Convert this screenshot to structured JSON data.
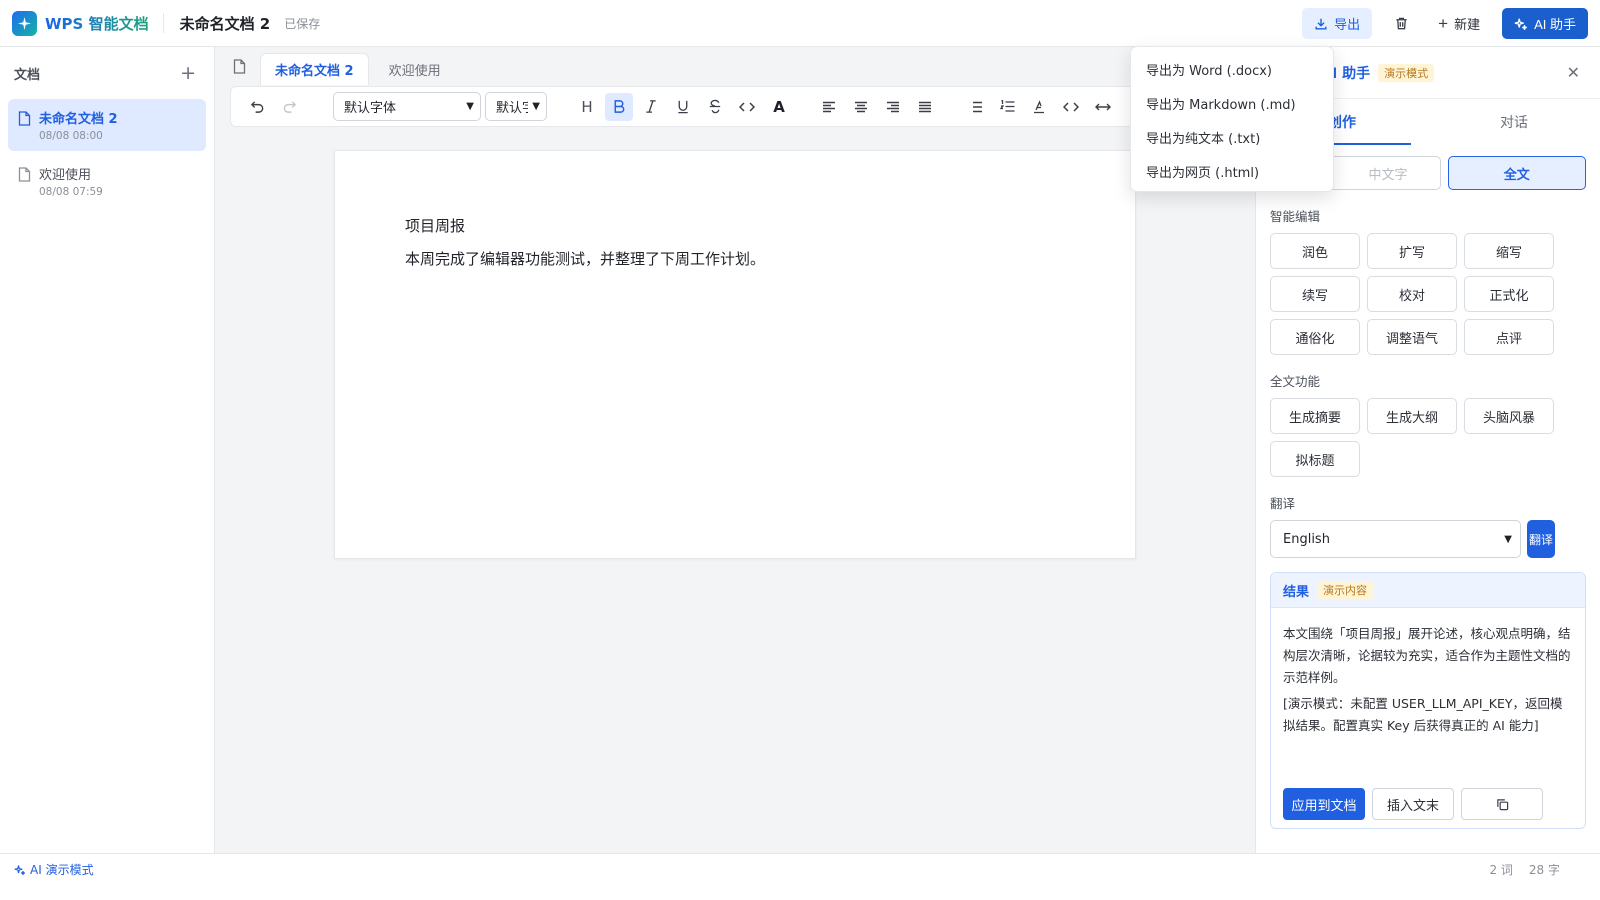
{
  "header": {
    "app_name": "WPS 智能文档",
    "doc_title": "未命名文档 2",
    "save_status": "已保存",
    "export_label": "导出",
    "new_label": "新建",
    "ai_label": "AI 助手"
  },
  "sidebar": {
    "title": "文档",
    "add": "+",
    "items": [
      {
        "name": "未命名文档 2",
        "date": "08/08 08:00",
        "active": true
      },
      {
        "name": "欢迎使用",
        "date": "08/08 07:59",
        "active": false
      }
    ]
  },
  "tabs": [
    {
      "label": "未命名文档 2",
      "active": true
    },
    {
      "label": "欢迎使用",
      "active": false
    }
  ],
  "toolbar": {
    "font_family": "默认字体",
    "font_size": "默认字"
  },
  "editor": {
    "line1": "项目周报",
    "line2": "本周完成了编辑器功能测试，并整理了下周工作计划。"
  },
  "panel": {
    "title": "I 助手",
    "badge": "演示模式",
    "tabs": [
      "创作",
      "对话"
    ],
    "scope": {
      "selection_placeholder": "中文字",
      "full": "全文"
    },
    "smart_edit": {
      "title": "智能编辑",
      "buttons": [
        "润色",
        "扩写",
        "缩写",
        "续写",
        "校对",
        "正式化",
        "通俗化",
        "调整语气",
        "点评"
      ]
    },
    "full_text": {
      "title": "全文功能",
      "buttons": [
        "生成摘要",
        "生成大纲",
        "头脑风暴",
        "拟标题"
      ]
    },
    "translate": {
      "title": "翻译",
      "language": "English",
      "button": "翻译"
    },
    "result": {
      "title": "结果",
      "badge": "演示内容",
      "para1": "本文围绕「项目周报」展开论述，核心观点明确，结构层次清晰，论据较为充实，适合作为主题性文档的示范样例。",
      "para2": "[演示模式：未配置 USER_LLM_API_KEY，返回模拟结果。配置真实 Key 后获得真正的 AI 能力]",
      "apply": "应用到文档",
      "insert": "插入文末"
    }
  },
  "export_menu": {
    "items": [
      "导出为 Word (.docx)",
      "导出为 Markdown (.md)",
      "导出为纯文本 (.txt)",
      "导出为网页 (.html)"
    ]
  },
  "status": {
    "mode": "AI 演示模式",
    "words": "2 词",
    "chars": "28 字"
  },
  "colors": {
    "accent": "#1f5fe0",
    "ai_button": "#1b5fcf",
    "badge_bg": "#fff4d6"
  }
}
